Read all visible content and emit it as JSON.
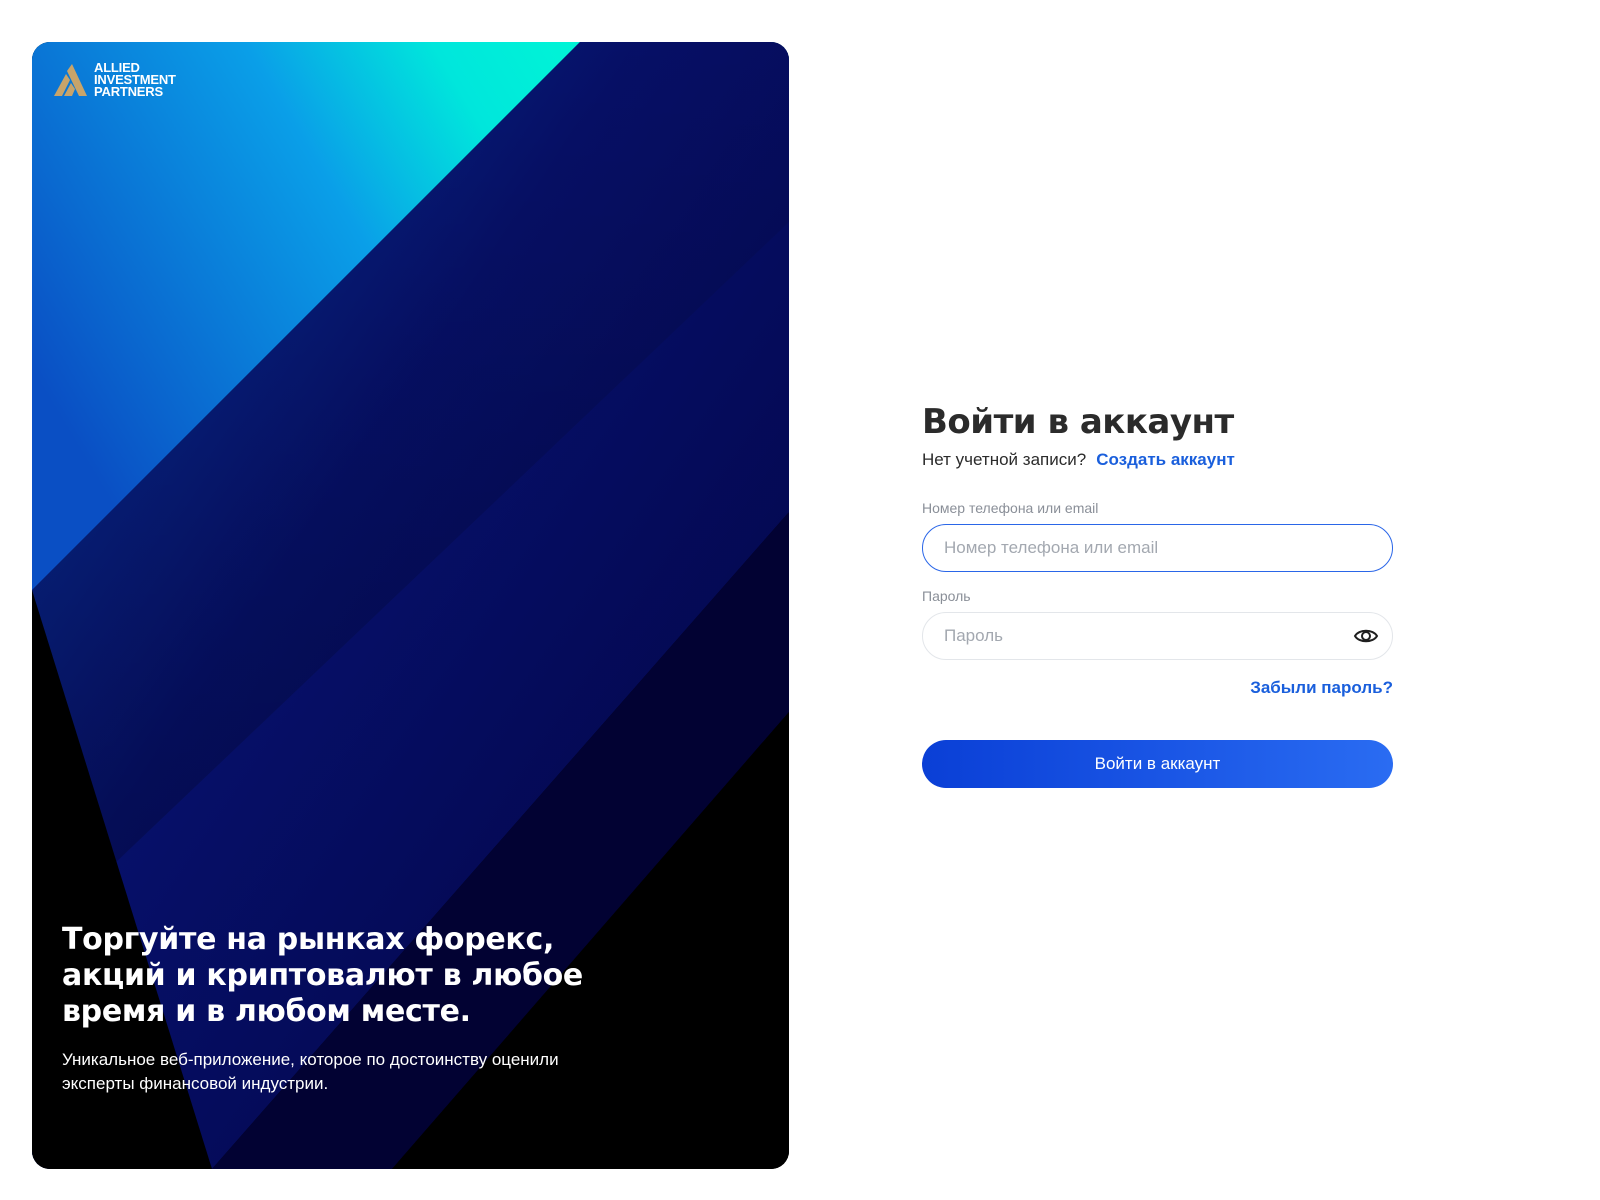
{
  "brand": {
    "logo_lines": [
      "ALLIED",
      "INVESTMENT",
      "PARTNERS"
    ],
    "logo_icon": "allied-logo-icon",
    "colors": {
      "logo_gold": "#c8a46a",
      "accent_blue": "#1a5fdc",
      "cyan": "#00f0d8",
      "deep_blue": "#0a0a6e"
    }
  },
  "hero": {
    "title": "Торгуйте на рынках форекс, акций и криптовалют в любое время и в любом месте.",
    "subtitle": "Уникальное веб-приложение, которое по достоинству оценили эксперты финансовой индустрии."
  },
  "login": {
    "title": "Войти в аккаунт",
    "no_account_text": "Нет учетной записи?",
    "create_account_link": "Создать аккаунт",
    "email_label": "Номер телефона или email",
    "email_placeholder": "Номер телефона или email",
    "password_label": "Пароль",
    "password_placeholder": "Пароль",
    "password_toggle_icon": "eye-icon",
    "forgot_password_link": "Забыли пароль?",
    "submit_button": "Войти в аккаунт"
  }
}
